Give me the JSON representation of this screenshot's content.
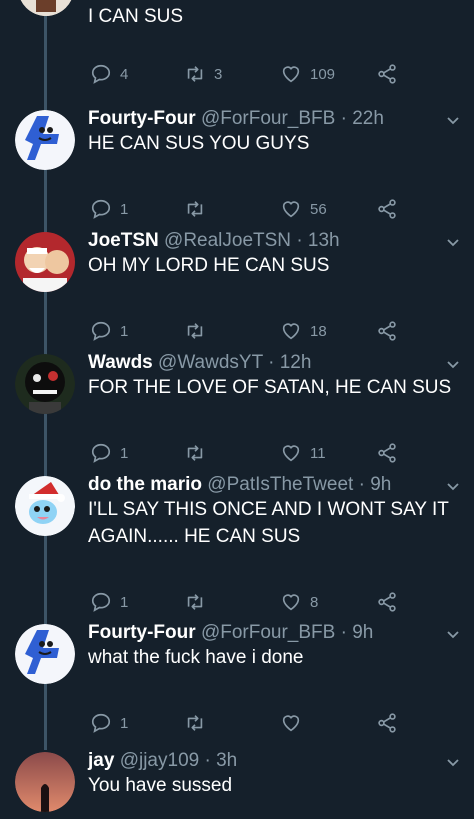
{
  "top_tweet": {
    "text": "I CAN SUS",
    "replies": "4",
    "retweets": "3",
    "likes": "109"
  },
  "tweets": [
    {
      "name": "Fourty-Four",
      "handle": "@ForFour_BFB",
      "time": "22h",
      "text": "HE CAN SUS YOU GUYS",
      "replies": "1",
      "retweets": "",
      "likes": "56",
      "avatar": "blue-four-character"
    },
    {
      "name": "JoeTSN",
      "handle": "@RealJoeTSN",
      "time": "13h",
      "text": "OH MY LORD HE CAN SUS",
      "replies": "1",
      "retweets": "",
      "likes": "18",
      "avatar": "colonel-sanders"
    },
    {
      "name": "Wawds",
      "handle": "@WawdsYT",
      "time": "12h",
      "text": "FOR THE LOVE OF SATAN, HE CAN SUS",
      "replies": "1",
      "retweets": "",
      "likes": "11",
      "avatar": "dark-creature"
    },
    {
      "name": "do the mario",
      "handle": "@PatIsTheTweet",
      "time": "9h",
      "text": "I'LL SAY THIS ONCE AND I WONT SAY IT AGAIN...... HE CAN SUS",
      "replies": "1",
      "retweets": "",
      "likes": "8",
      "avatar": "santa-hat-creature"
    },
    {
      "name": "Fourty-Four",
      "handle": "@ForFour_BFB",
      "time": "9h",
      "text": "what the fuck have i done",
      "replies": "1",
      "retweets": "",
      "likes": "",
      "avatar": "blue-four-character"
    },
    {
      "name": "jay",
      "handle": "@jjay109",
      "time": "3h",
      "text": "You have sussed",
      "replies": "",
      "retweets": "",
      "likes": "",
      "avatar": "sunset-silhouette"
    }
  ],
  "separator": "·",
  "colors": {
    "background": "#15202b",
    "muted": "#8899a6",
    "thread_line": "#3d5466"
  }
}
